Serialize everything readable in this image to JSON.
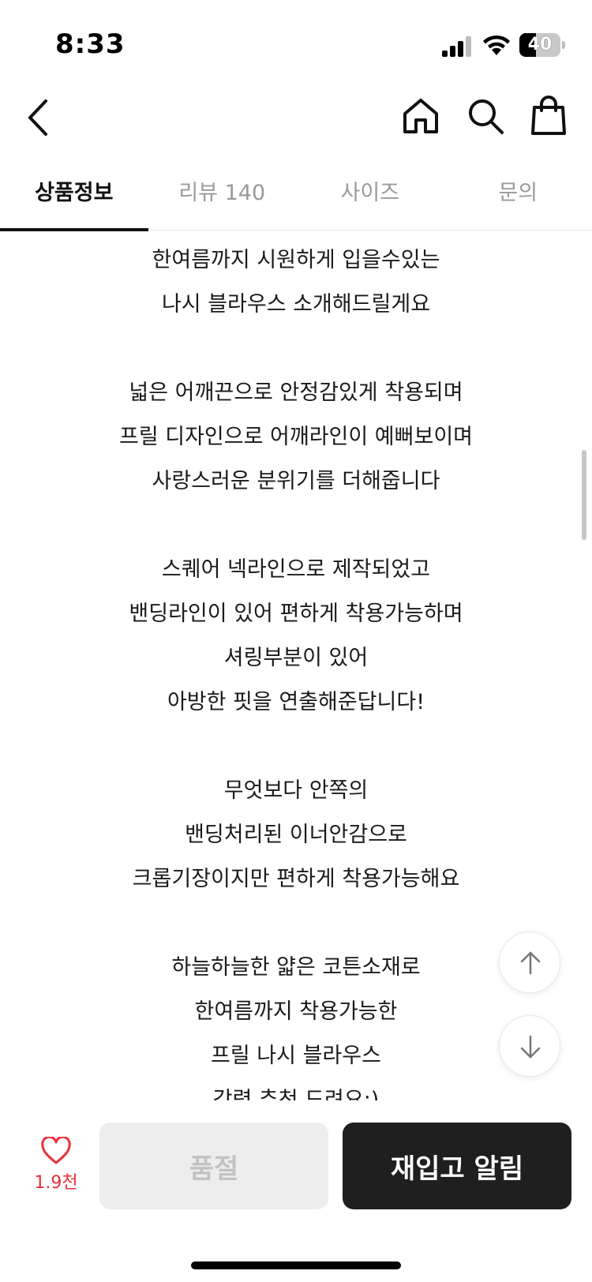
{
  "status_bar": {
    "time": "8:33",
    "battery_percent": 40,
    "battery_label": "40",
    "signal_icon": "cellular-signal-icon",
    "wifi_icon": "wifi-icon"
  },
  "nav": {
    "back_icon": "back-chevron-icon",
    "home_icon": "home-icon",
    "search_icon": "search-icon",
    "bag_icon": "shopping-bag-icon"
  },
  "tabs": [
    {
      "label": "상품정보",
      "active": true
    },
    {
      "label": "리뷰 140",
      "active": false
    },
    {
      "label": "사이즈",
      "active": false
    },
    {
      "label": "문의",
      "active": false
    }
  ],
  "description_lines": [
    "한여름까지 시원하게 입을수있는",
    "나시 블라우스 소개해드릴게요",
    "",
    "넓은 어깨끈으로 안정감있게 착용되며",
    "프릴 디자인으로 어깨라인이 예뻐보이며",
    "사랑스러운 분위기를 더해줍니다",
    "",
    "스퀘어 넥라인으로 제작되었고",
    "밴딩라인이 있어 편하게 착용가능하며",
    "셔링부분이 있어",
    "아방한 핏을 연출해준답니다!",
    "",
    "무엇보다 안쪽의",
    "밴딩처리된 이너안감으로",
    "크롭기장이지만 편하게 착용가능해요",
    "",
    "하늘하늘한 얇은 코튼소재로",
    "한여름까지 착용가능한",
    "프릴 나시 블라우스",
    "강력 추천 드려요:)"
  ],
  "floating": {
    "scroll_up_icon": "arrow-up-icon",
    "scroll_down_icon": "arrow-down-icon"
  },
  "bottom_bar": {
    "like_icon": "heart-icon",
    "like_count": "1.9천",
    "soldout_label": "품절",
    "restock_label": "재입고 알림"
  },
  "colors": {
    "accent_red": "#e8313a",
    "button_dark": "#1f1f1f",
    "button_disabled": "#ededed",
    "tab_inactive": "#9a9a9a"
  }
}
